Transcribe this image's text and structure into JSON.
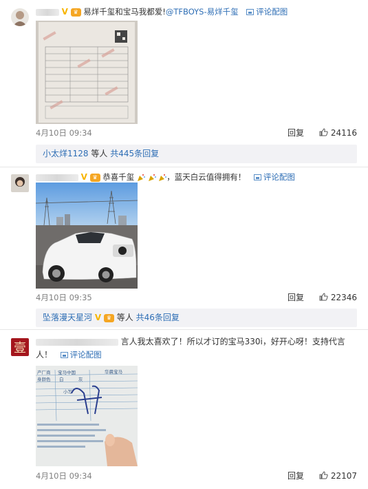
{
  "comments": [
    {
      "text": "易烊千玺和宝马我都爱!",
      "mention": "@TFBOYS-易烊千玺",
      "pic_link": "评论配图",
      "time": "4月10日 09:34",
      "reply_label": "回复",
      "likes": "24116",
      "reply_summary": {
        "user": "小太烊1128",
        "suffix": "等人",
        "count": "共445条回复"
      }
    },
    {
      "text_prefix": "恭喜千玺",
      "text_suffix": "，蓝天白云值得拥有！",
      "pic_link": "评论配图",
      "time": "4月10日 09:35",
      "reply_label": "回复",
      "likes": "22346",
      "reply_summary": {
        "user": "坠落漫天星河",
        "suffix": "等人",
        "count": "共46条回复"
      }
    },
    {
      "text_line1": "言人我太喜欢了！所以才订的宝马330i，好开心呀！支持代言",
      "text_line2": "人！",
      "pic_link": "评论配图",
      "time": "4月10日 09:34",
      "reply_label": "回复",
      "likes": "22107"
    }
  ],
  "doc_labels": {
    "maker": "产厂商",
    "brand": "宝马中国",
    "brand2": "华晨宝马",
    "color": "身颜色",
    "white": "白",
    "gray": "灰",
    "note": "小写"
  },
  "colors": {
    "link_blue": "#2e6eb5",
    "mention_orange": "#eb7350",
    "reply_bg": "#f2f2f5",
    "meta_gray": "#808080"
  }
}
